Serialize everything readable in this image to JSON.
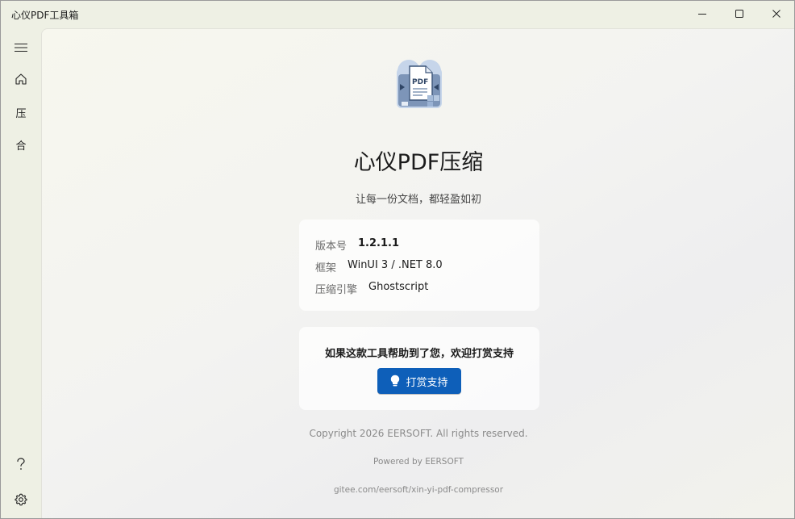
{
  "window": {
    "title": "心仪PDF工具箱"
  },
  "nav": {
    "items": [
      {
        "name": "menu",
        "icon": "hamburger-icon"
      },
      {
        "name": "home",
        "icon": "home-icon"
      },
      {
        "name": "compress",
        "label": "压"
      },
      {
        "name": "merge",
        "label": "合"
      }
    ],
    "bottom_items": [
      {
        "name": "help",
        "icon": "question-icon"
      },
      {
        "name": "settings",
        "icon": "gear-icon"
      }
    ]
  },
  "about": {
    "app_name": "心仪PDF压缩",
    "slogan": "让每一份文档，都轻盈如初",
    "logo_text": "PDF",
    "info": [
      {
        "key": "版本号",
        "value": "1.2.1.1"
      },
      {
        "key": "框架",
        "value": "WinUI 3 / .NET 8.0"
      },
      {
        "key": "压缩引擎",
        "value": "Ghostscript"
      }
    ],
    "support_text": "如果这款工具帮助到了您，欢迎打赏支持",
    "donate_label": "打赏支持",
    "copyright": "Copyright 2026 EERSOFT. All rights reserved.",
    "powered_by": "Powered by EERSOFT",
    "repo": "gitee.com/eersoft/xin-yi-pdf-compressor"
  },
  "colors": {
    "accent": "#0e5fb9",
    "background": "#eef0e4"
  }
}
